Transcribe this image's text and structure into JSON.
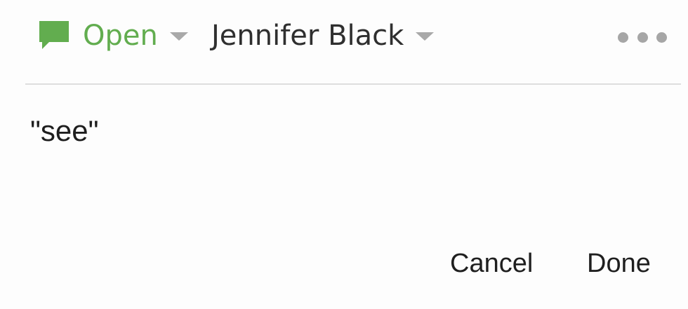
{
  "header": {
    "status": {
      "icon": "speech-bubble-icon",
      "label": "Open",
      "color": "#62ad4f"
    },
    "assignee": {
      "label": "Jennifer Black"
    },
    "more_icon": "more-dots-icon"
  },
  "comment": {
    "text": "\"see\""
  },
  "footer": {
    "cancel_label": "Cancel",
    "done_label": "Done"
  },
  "colors": {
    "accent": "#62ad4f",
    "caret": "#a9a9a9",
    "divider": "#dedede",
    "text": "#1f1f1f"
  }
}
